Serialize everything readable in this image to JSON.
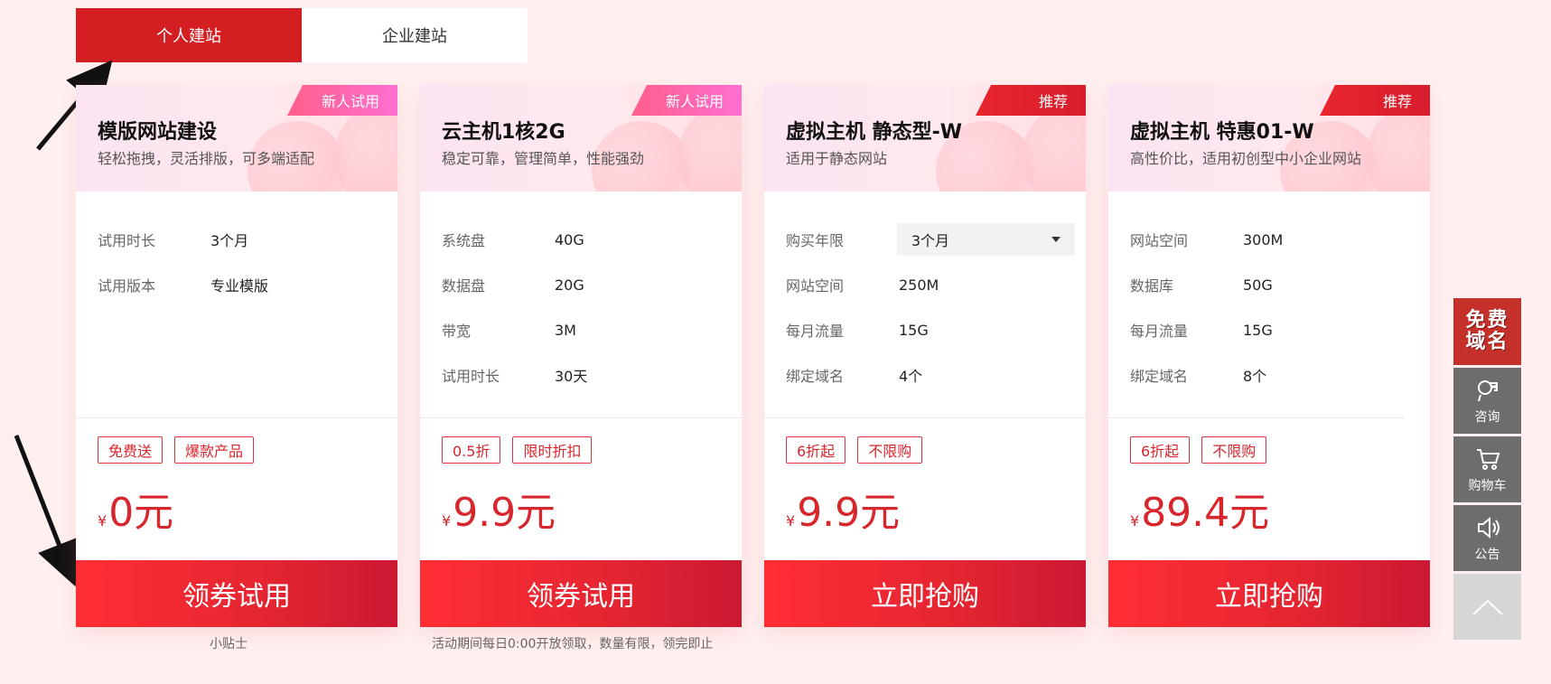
{
  "tabs": [
    {
      "label": "个人建站",
      "active": true
    },
    {
      "label": "企业建站",
      "active": false
    }
  ],
  "cards": [
    {
      "badge": "新人试用",
      "title": "模版网站建设",
      "subtitle": "轻松拖拽，灵活排版，可多端适配",
      "specs": [
        {
          "label": "试用时长",
          "value": "3个月"
        },
        {
          "label": "试用版本",
          "value": "专业模版"
        }
      ],
      "tags": [
        "免费送",
        "爆款产品"
      ],
      "currency": "¥",
      "price": "0元",
      "cta": "领券试用",
      "footnote": "小贴士"
    },
    {
      "badge": "新人试用",
      "title": "云主机1核2G",
      "subtitle": "稳定可靠，管理简单，性能强劲",
      "specs": [
        {
          "label": "系统盘",
          "value": "40G"
        },
        {
          "label": "数据盘",
          "value": "20G"
        },
        {
          "label": "带宽",
          "value": "3M"
        },
        {
          "label": "试用时长",
          "value": "30天"
        }
      ],
      "tags": [
        "0.5折",
        "限时折扣"
      ],
      "currency": "¥",
      "price": "9.9元",
      "cta": "领券试用",
      "footnote": "活动期间每日0:00开放领取，数量有限，领完即止"
    },
    {
      "badge": "推荐",
      "title": "虚拟主机 静态型-W",
      "subtitle": "适用于静态网站",
      "select": {
        "label": "购买年限",
        "value": "3个月"
      },
      "specs": [
        {
          "label": "网站空间",
          "value": "250M"
        },
        {
          "label": "每月流量",
          "value": "15G"
        },
        {
          "label": "绑定域名",
          "value": "4个"
        }
      ],
      "tags": [
        "6折起",
        "不限购"
      ],
      "currency": "¥",
      "price": "9.9元",
      "cta": "立即抢购"
    },
    {
      "badge": "推荐",
      "title": "虚拟主机 特惠01-W",
      "subtitle": "高性价比，适用初创型中小企业网站",
      "specs": [
        {
          "label": "网站空间",
          "value": "300M"
        },
        {
          "label": "数据库",
          "value": "50G"
        },
        {
          "label": "每月流量",
          "value": "15G"
        },
        {
          "label": "绑定域名",
          "value": "8个"
        }
      ],
      "tags": [
        "6折起",
        "不限购"
      ],
      "currency": "¥",
      "price": "89.4元",
      "cta": "立即抢购"
    }
  ],
  "sidebar": {
    "promo_line1": "免费",
    "promo_line2": "域名",
    "items": [
      {
        "label": "咨询",
        "icon": "consult-icon"
      },
      {
        "label": "购物车",
        "icon": "cart-icon"
      },
      {
        "label": "公告",
        "icon": "speaker-icon"
      }
    ],
    "top_icon": "chevron-up-icon"
  },
  "colors": {
    "brand_red": "#d31f22",
    "badge_pink": "#ff5f8a",
    "background": "#fff0f0"
  }
}
